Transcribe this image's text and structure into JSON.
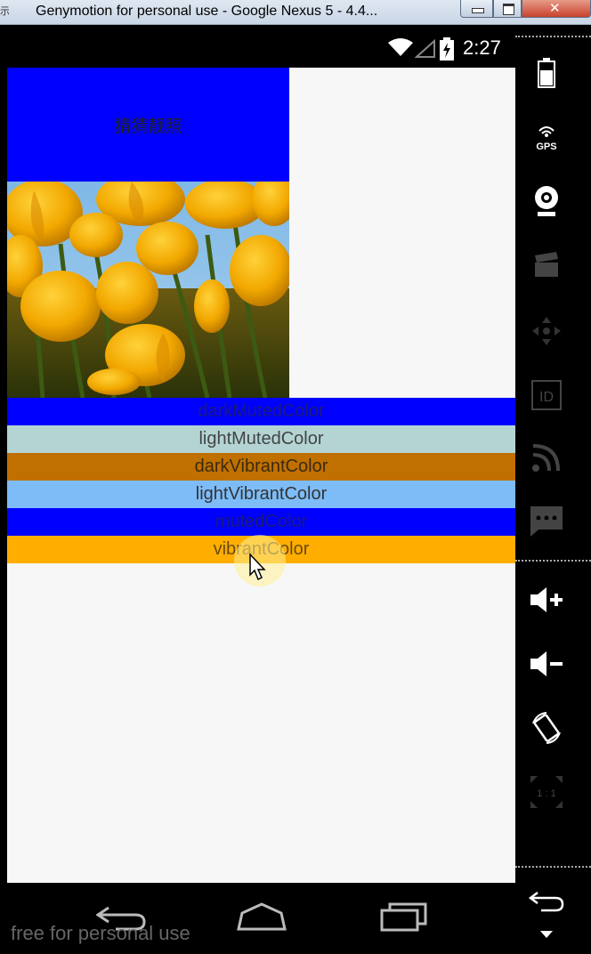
{
  "window": {
    "icon_glyph": "示",
    "title": "Genymotion for personal use - Google Nexus 5 - 4.4..."
  },
  "statusbar": {
    "time": "2:27",
    "icons": [
      "wifi-icon",
      "signal-icon",
      "battery-charging-icon"
    ]
  },
  "app": {
    "header_text": "猜猜靓照",
    "image_alt": "yellow tulips photo",
    "color_rows": [
      {
        "label": "darkMutedColor",
        "bg": "#0000ff",
        "fg": "#1a1a7a"
      },
      {
        "label": "lightMutedColor",
        "bg": "#b4d4d4",
        "fg": "#444444"
      },
      {
        "label": "darkVibrantColor",
        "bg": "#c07000",
        "fg": "#3a2a10"
      },
      {
        "label": "lightVibrantColor",
        "bg": "#7dbcf7",
        "fg": "#333333"
      },
      {
        "label": "mutedColor",
        "bg": "#0000ff",
        "fg": "#1a1a7a"
      },
      {
        "label": "vibrantColor",
        "bg": "#ffae00",
        "fg": "#6a4a10"
      }
    ]
  },
  "navbar": {
    "icons": [
      "back-icon",
      "home-icon",
      "recents-icon"
    ]
  },
  "watermark": "free for personal use",
  "sidebar": {
    "gps_label": "GPS",
    "id_label": "ID",
    "ratio_label": "1 : 1",
    "icons": [
      "battery-icon",
      "gps-icon",
      "webcam-icon",
      "video-capture-icon",
      "dpad-icon",
      "id-icon",
      "cast-icon",
      "sms-icon",
      "volume-up-icon",
      "volume-down-icon",
      "rotate-icon",
      "scale-icon",
      "back-icon",
      "menu-icon"
    ]
  }
}
